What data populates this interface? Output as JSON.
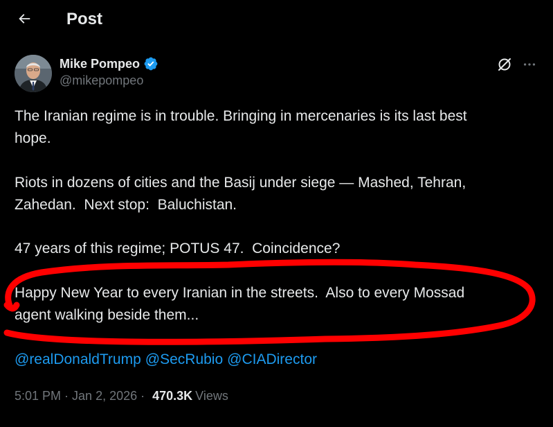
{
  "header": {
    "back_icon": "arrow-left-icon",
    "title": "Post"
  },
  "author": {
    "name": "Mike Pompeo",
    "handle": "@mikepompeo",
    "verified_color": "#1d9bf0",
    "verified_icon": "verified-badge-icon"
  },
  "actions": {
    "grok_icon": "grok-icon",
    "more_icon": "more-horizontal-icon"
  },
  "post": {
    "paragraphs": [
      "The Iranian regime is in trouble. Bringing in mercenaries is its last best\nhope.",
      "Riots in dozens of cities and the Basij under siege — Mashed, Tehran,\nZahedan.  Next stop:  Baluchistan.",
      "47 years of this regime; POTUS 47.  Coincidence?",
      "Happy New Year to every Iranian in the streets.  Also to every Mossad\nagent walking beside them..."
    ],
    "mentions": [
      "@realDonaldTrump",
      "@SecRubio",
      "@CIADirector"
    ],
    "mention_color": "#1d9bf0"
  },
  "meta": {
    "time": "5:01 PM",
    "separator1": "·",
    "date": "Jan 2, 2026",
    "separator2": "·",
    "views_count": "470.3K",
    "views_label": "Views"
  },
  "annotation": {
    "color": "#ff0000"
  }
}
